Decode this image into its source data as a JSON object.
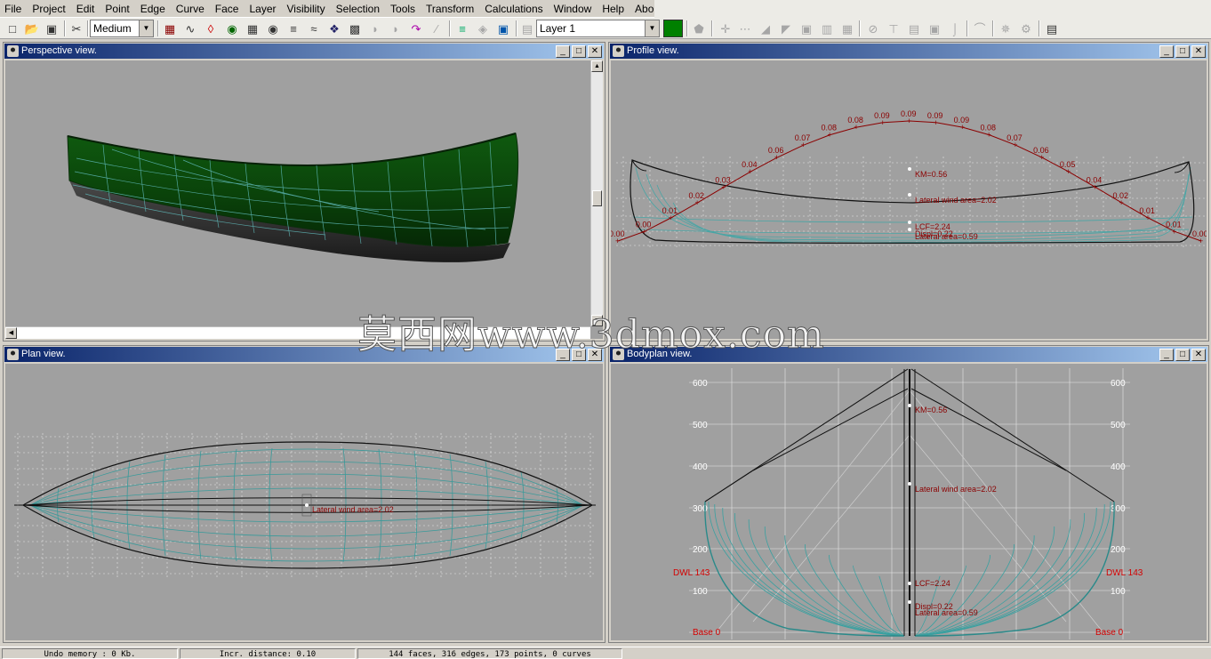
{
  "menu": [
    "File",
    "Project",
    "Edit",
    "Point",
    "Edge",
    "Curve",
    "Face",
    "Layer",
    "Visibility",
    "Selection",
    "Tools",
    "Transform",
    "Calculations",
    "Window",
    "Help",
    "About"
  ],
  "toolbar": {
    "precision_value": "Medium",
    "layer_value": "Layer 1",
    "layer_color": "#008000",
    "icons_group1": [
      "new-file-icon",
      "open-file-icon",
      "save-icon"
    ],
    "icons_group2": [
      "control-net-icon",
      "interior-edges-icon",
      "curvature-icon",
      "shade-icon",
      "grid-icon",
      "stations-icon",
      "buttocks-icon",
      "waterlines-icon",
      "diagonals-icon",
      "hydrostatic-features-icon",
      "flowlines-icon",
      "markers-icon",
      "zebra-icon",
      "curvature-plot-icon"
    ],
    "icons_group3": [
      "add-layer-icon",
      "delete-layer-icon",
      "layer-props-icon"
    ],
    "icons_group4": [
      "new-face-icon",
      "add-point-icon",
      "collapse-point-icon",
      "insert-plane-icon",
      "intersect-icon",
      "lock-icon",
      "unlock-icon",
      "unlock-all-icon",
      "extract-point-icon",
      "connect-points-icon",
      "split-edge-icon",
      "crease-icon",
      "new-edge-icon",
      "new-curve-icon",
      "check-model-icon",
      "remove-unused-icon",
      "delete-negative-icon",
      "design-hydrostatics-icon"
    ]
  },
  "viewports": {
    "perspective": {
      "title": "Perspective view."
    },
    "profile": {
      "title": "Profile view.",
      "sac_labels": [
        "0.00",
        "0.00",
        "0.01",
        "0.02",
        "0.03",
        "0.04",
        "0.06",
        "0.07",
        "0.08",
        "0.08",
        "0.09",
        "0.09",
        "0.09",
        "0.09",
        "0.08",
        "0.07",
        "0.06",
        "0.05",
        "0.04",
        "0.02",
        "0.01",
        "0.01",
        "0.00"
      ],
      "hydro_labels": {
        "km": "KM=0.56",
        "lateral_wind": "Lateral wind area=2.02",
        "lcf": "LCF=2.24",
        "displ": "Displ=0.22",
        "lateral_area": "Lateral area=0.59"
      }
    },
    "plan": {
      "title": "Plan view.",
      "overlap_label": "Lateral wind area=2.02"
    },
    "bodyplan": {
      "title": "Bodyplan view.",
      "y_ticks": [
        "600",
        "500",
        "400",
        "300",
        "200",
        "100"
      ],
      "dwl_label": "DWL 143",
      "base_label": "Base 0",
      "hydro_labels": {
        "km": "KM=0.56",
        "lateral_wind": "Lateral wind area=2.02",
        "lcf": "LCF=2.24",
        "displ": "Displ=0.22",
        "lateral_area": "Lateral area=0.59"
      }
    }
  },
  "watermark": "莫西网www.3dmox.com",
  "status": {
    "undo": "Undo memory : 0 Kb.",
    "increment": "Incr. distance: 0.10",
    "model_info": "144 faces, 316 edges, 173 points, 0 curves"
  }
}
